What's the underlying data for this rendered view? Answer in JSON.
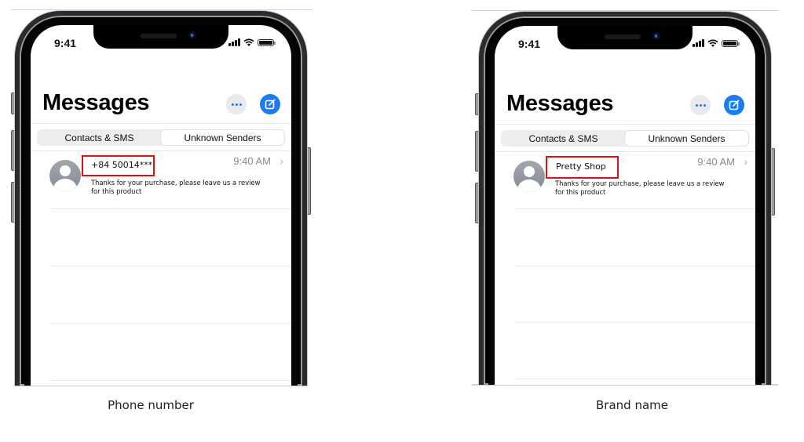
{
  "panels": [
    {
      "caption": "Phone number",
      "status_bar": {
        "time": "9:41",
        "icons": [
          "cellular-signal-icon",
          "wifi-icon",
          "battery-icon"
        ]
      },
      "header": {
        "title": "Messages",
        "more_icon": "ellipsis-icon",
        "compose_icon": "compose-icon"
      },
      "segmented_control": {
        "tabs": [
          "Contacts & SMS",
          "Unknown Senders"
        ],
        "selected": "Unknown Senders"
      },
      "messages": [
        {
          "sender": "+84 50014***",
          "time": "9:40 AM",
          "preview": "Thanks for your purchase, please leave us a review for this product",
          "highlighted": true
        }
      ]
    },
    {
      "caption": "Brand name",
      "status_bar": {
        "time": "9:41",
        "icons": [
          "cellular-signal-icon",
          "wifi-icon",
          "battery-icon"
        ]
      },
      "header": {
        "title": "Messages",
        "more_icon": "ellipsis-icon",
        "compose_icon": "compose-icon"
      },
      "segmented_control": {
        "tabs": [
          "Contacts & SMS",
          "Unknown Senders"
        ],
        "selected": "Unknown Senders"
      },
      "messages": [
        {
          "sender": "Pretty Shop",
          "time": "9:40 AM",
          "preview": "Thanks for your purchase, please leave us a review for this product",
          "highlighted": true
        }
      ]
    }
  ],
  "colors": {
    "accent": "#1a7cf0",
    "highlight": "#e01010",
    "secondary_text": "#8a8a8e"
  }
}
